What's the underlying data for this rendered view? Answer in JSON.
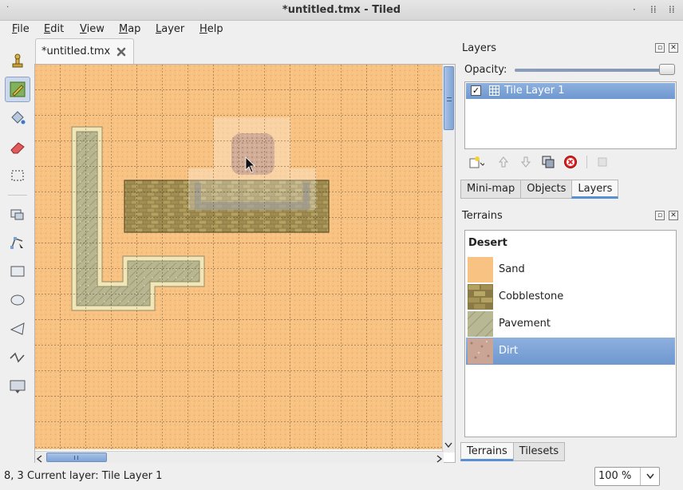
{
  "window": {
    "title": "*untitled.tmx - Tiled"
  },
  "menu": [
    {
      "label": "File",
      "underline": "F",
      "rest": "ile"
    },
    {
      "label": "Edit",
      "underline": "E",
      "rest": "dit"
    },
    {
      "label": "View",
      "underline": "V",
      "rest": "iew"
    },
    {
      "label": "Map",
      "underline": "M",
      "rest": "ap"
    },
    {
      "label": "Layer",
      "underline": "L",
      "rest": "ayer"
    },
    {
      "label": "Help",
      "underline": "H",
      "rest": "elp"
    }
  ],
  "tools": [
    "stamp-brush",
    "terrain-brush",
    "bucket-fill",
    "eraser",
    "rectangle-select",
    "magic-wand",
    "edit-polygons",
    "insert-rectangle",
    "insert-ellipse",
    "insert-polygon",
    "insert-polyline",
    "insert-tile"
  ],
  "active_tool": "terrain-brush",
  "document_tab": {
    "label": "*untitled.tmx"
  },
  "layers_panel": {
    "title": "Layers",
    "opacity_label": "Opacity:",
    "opacity": 1.0,
    "layers": [
      {
        "name": "Tile Layer 1",
        "visible": true,
        "selected": true
      }
    ]
  },
  "dock_tabs_top": [
    {
      "label": "Mini-map",
      "selected": false
    },
    {
      "label": "Objects",
      "selected": false
    },
    {
      "label": "Layers",
      "selected": true
    }
  ],
  "terrains_panel": {
    "title": "Terrains",
    "group": "Desert",
    "items": [
      {
        "name": "Sand",
        "selected": false
      },
      {
        "name": "Cobblestone",
        "selected": false
      },
      {
        "name": "Pavement",
        "selected": false
      },
      {
        "name": "Dirt",
        "selected": true
      }
    ]
  },
  "dock_tabs_bottom": [
    {
      "label": "Terrains",
      "selected": true
    },
    {
      "label": "Tilesets",
      "selected": false
    }
  ],
  "status": {
    "text": "8, 3  Current layer: Tile Layer 1"
  },
  "zoom": {
    "value": "100 %"
  },
  "colors": {
    "sand": "#f8c282",
    "selection": "#7aa0d4",
    "cobblestone": "#8a7a45",
    "pavement": "#b9b894"
  }
}
